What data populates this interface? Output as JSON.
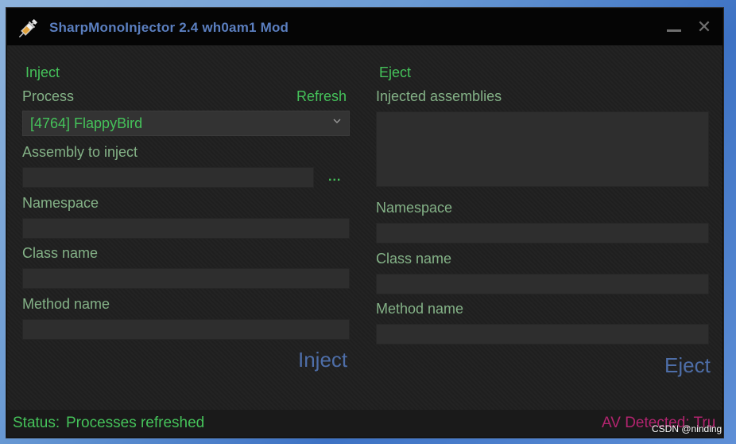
{
  "window": {
    "title": "SharpMonoInjector 2.4 wh0am1 Mod",
    "icon": "syringe-icon"
  },
  "inject": {
    "section_title": "Inject",
    "process_label": "Process",
    "refresh_label": "Refresh",
    "process_selected": "[4764] FlappyBird",
    "assembly_label": "Assembly to inject",
    "assembly_value": "",
    "browse_label": "...",
    "namespace_label": "Namespace",
    "namespace_value": "",
    "classname_label": "Class name",
    "classname_value": "",
    "method_label": "Method name",
    "method_value": "",
    "inject_button": "Inject"
  },
  "eject": {
    "section_title": "Eject",
    "assemblies_label": "Injected assemblies",
    "assemblies": [],
    "namespace_label": "Namespace",
    "namespace_value": "",
    "classname_label": "Class name",
    "classname_value": "",
    "method_label": "Method name",
    "method_value": "",
    "eject_button": "Eject"
  },
  "status": {
    "label": "Status:",
    "text": "Processes refreshed",
    "av_text": "AV Detected: Tru"
  },
  "watermark": "CSDN @ninding",
  "colors": {
    "label_green": "#84b287",
    "accent_green": "#45c25a",
    "button_blue": "#4e6ea8",
    "title_blue": "#5b7fc0",
    "av_magenta": "#b2246f",
    "window_bg": "#1f1f1f"
  }
}
